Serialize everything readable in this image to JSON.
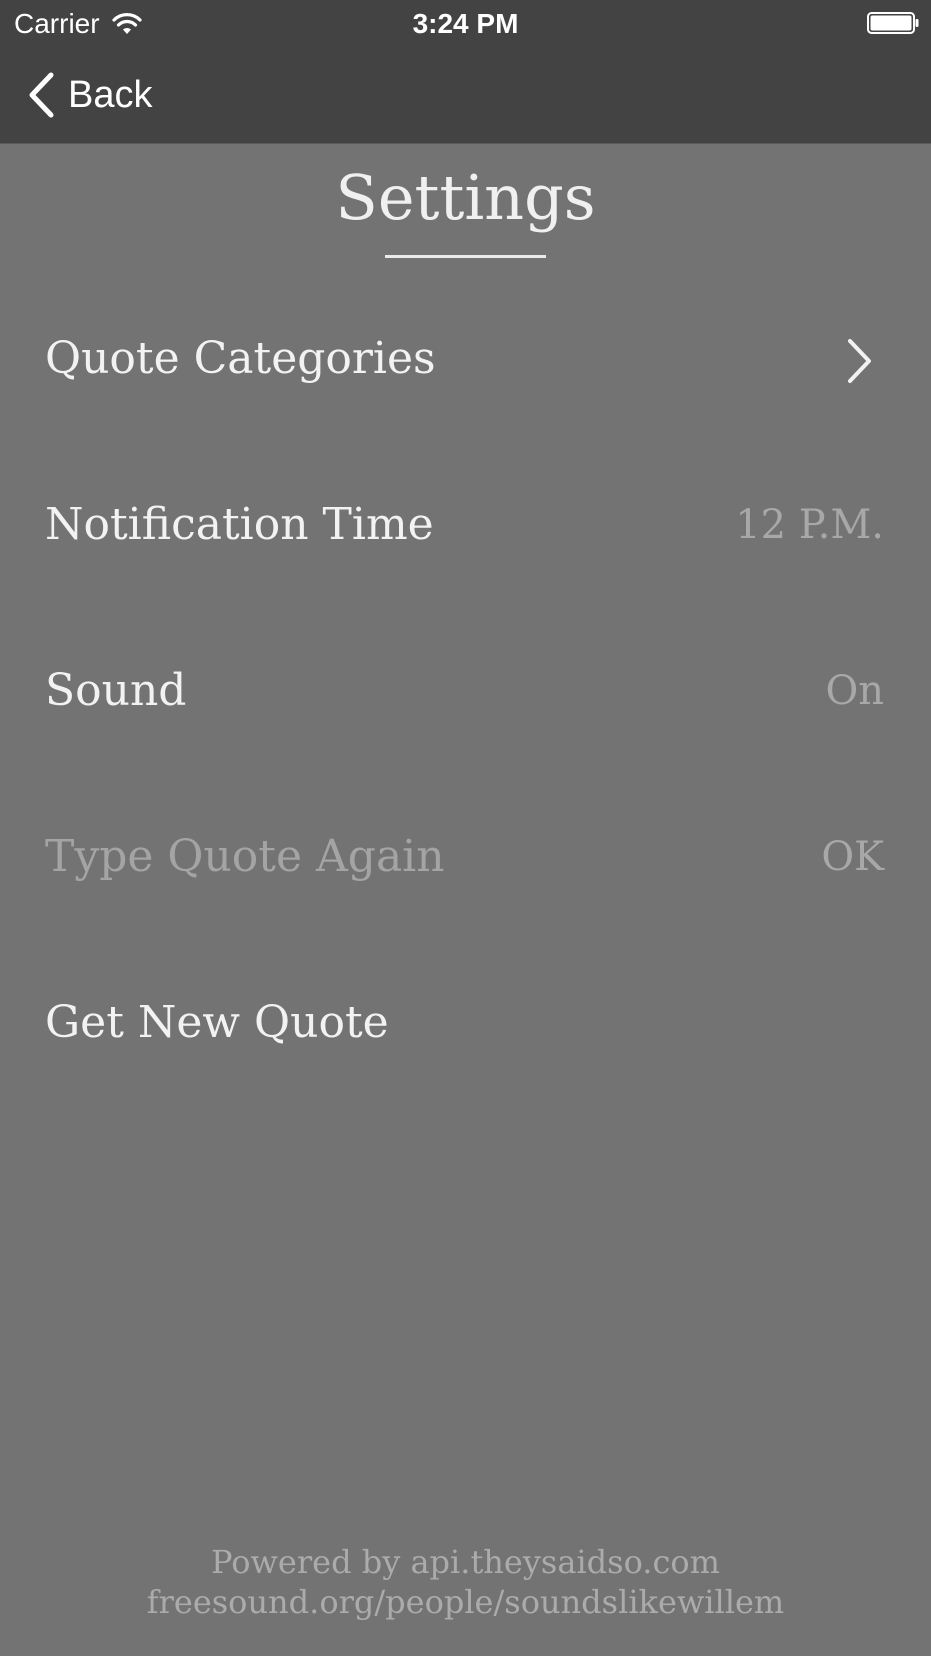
{
  "status_bar": {
    "carrier": "Carrier",
    "time": "3:24 PM",
    "wifi_icon": "wifi-icon",
    "battery_icon": "battery-icon"
  },
  "nav": {
    "back_label": "Back",
    "back_icon": "chevron-left-icon"
  },
  "page": {
    "title": "Settings"
  },
  "settings": [
    {
      "label": "Quote Categories",
      "value": "",
      "icon": "chevron-right-icon",
      "enabled": true
    },
    {
      "label": "Notification Time",
      "value": "12 P.M.",
      "enabled": true
    },
    {
      "label": "Sound",
      "value": "On",
      "enabled": true
    },
    {
      "label": "Type Quote Again",
      "value": "OK",
      "enabled": false
    },
    {
      "label": "Get New Quote",
      "value": "",
      "enabled": true
    }
  ],
  "footer": {
    "line1": "Powered by api.theysaidso.com",
    "line2": "freesound.org/people/soundslikewillem"
  },
  "colors": {
    "background": "#737373",
    "bar": "#434343",
    "text": "#f2f2f2",
    "muted_text": "#a8a8a8"
  }
}
